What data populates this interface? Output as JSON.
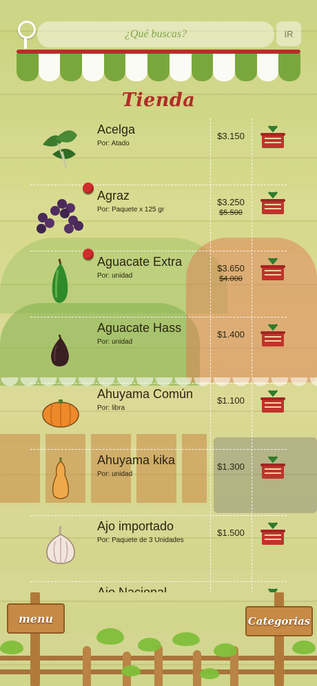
{
  "search": {
    "placeholder": "¿Qué buscas?",
    "go_label": "IR"
  },
  "title": "Tienda",
  "products": [
    {
      "name": "Acelga",
      "unit": "Por: Atado",
      "price": "$3.150",
      "old_price": "",
      "promo": false,
      "icon": "chard-icon"
    },
    {
      "name": "Agraz",
      "unit": "Por: Paquete x 125 gr",
      "price": "$3.250",
      "old_price": "$5.500",
      "promo": true,
      "icon": "agraz-berries-icon"
    },
    {
      "name": "Aguacate Extra",
      "unit": "Por: unidad",
      "price": "$3.650",
      "old_price": "$4.000",
      "promo": true,
      "icon": "avocado-green-icon"
    },
    {
      "name": "Aguacate Hass",
      "unit": "Por: unidad",
      "price": "$1.400",
      "old_price": "",
      "promo": false,
      "icon": "avocado-hass-icon"
    },
    {
      "name": "Ahuyama Común",
      "unit": "Por: libra",
      "price": "$1.100",
      "old_price": "",
      "promo": false,
      "icon": "pumpkin-icon"
    },
    {
      "name": "Ahuyama kika",
      "unit": "Por: unidad",
      "price": "$1.300",
      "old_price": "",
      "promo": false,
      "icon": "squash-icon"
    },
    {
      "name": "Ajo importado",
      "unit": "Por: Paquete de 3 Unidades",
      "price": "$1.500",
      "old_price": "",
      "promo": false,
      "icon": "garlic-icon"
    },
    {
      "name": "Ajo Nacional",
      "unit": "",
      "price": "",
      "old_price": "",
      "promo": false,
      "icon": "garlic-icon"
    }
  ],
  "nav": {
    "menu_label": "menu",
    "categories_label": "Categorias"
  },
  "colors": {
    "awning_green": "#7aa73c",
    "title_red": "#b02d27",
    "cart_red": "#c0332c",
    "promo_red": "#d22b2b"
  }
}
